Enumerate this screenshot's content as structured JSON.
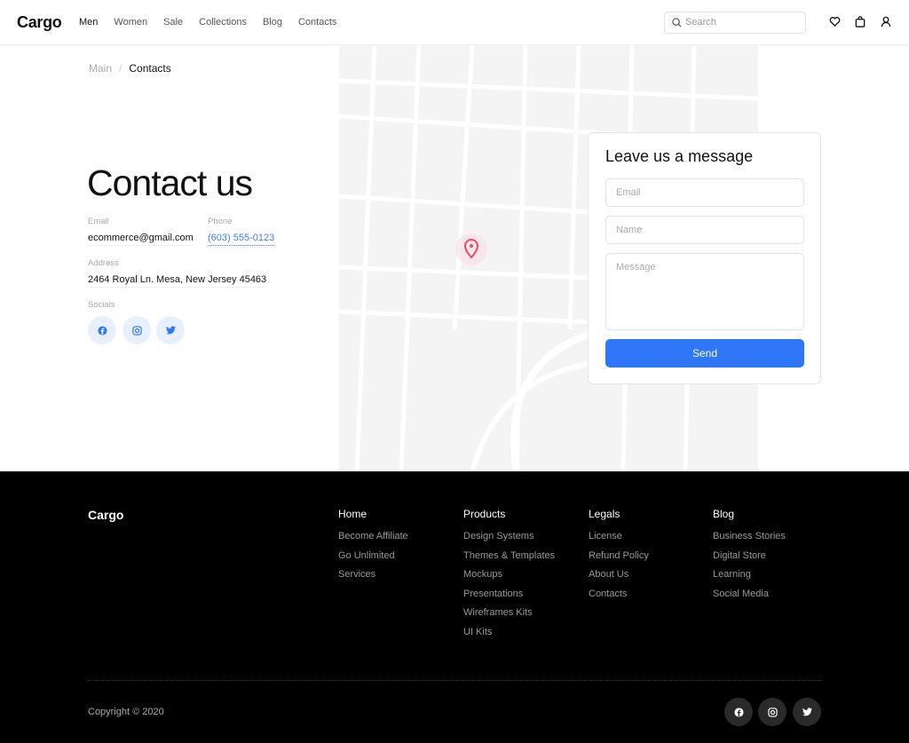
{
  "header": {
    "logo": "Cargo",
    "nav": [
      "Men",
      "Women",
      "Sale",
      "Collections",
      "Blog",
      "Contacts"
    ],
    "active": "Men",
    "search_placeholder": "Search",
    "icons": [
      "heart-icon",
      "bag-icon",
      "user-icon"
    ]
  },
  "breadcrumb": {
    "main": "Main",
    "separator": "/",
    "current": "Contacts"
  },
  "contact": {
    "title": "Contact us",
    "email_label": "Email",
    "email": "ecommerce@gmail.com",
    "phone_label": "Phone",
    "phone": "(603) 555-0123",
    "address_label": "Address",
    "address": "2464 Royal Ln. Mesa, New Jersey 45463",
    "socials_label": "Socials",
    "socials": [
      "facebook-icon",
      "instagram-icon",
      "twitter-icon"
    ]
  },
  "form": {
    "title": "Leave us a message",
    "email_placeholder": "Email",
    "name_placeholder": "Name",
    "message_placeholder": "Message",
    "send": "Send"
  },
  "footer": {
    "logo": "Cargo",
    "columns": [
      {
        "title": "Home",
        "links": [
          "Become Affiliate",
          "Go Unlimited",
          "Services"
        ]
      },
      {
        "title": "Products",
        "links": [
          "Design Systems",
          "Themes & Templates",
          "Mockups",
          "Presentations",
          "Wireframes Kits",
          "UI Kits"
        ]
      },
      {
        "title": "Legals",
        "links": [
          "License",
          "Refund Policy",
          "About Us",
          "Contacts"
        ]
      },
      {
        "title": "Blog",
        "links": [
          "Business Stories",
          "Digital Store",
          "Learning",
          "Social Media"
        ]
      }
    ],
    "copyright": "Copyright © 2020"
  },
  "colors": {
    "accent": "#2f77f6",
    "pin": "#f0476a"
  }
}
